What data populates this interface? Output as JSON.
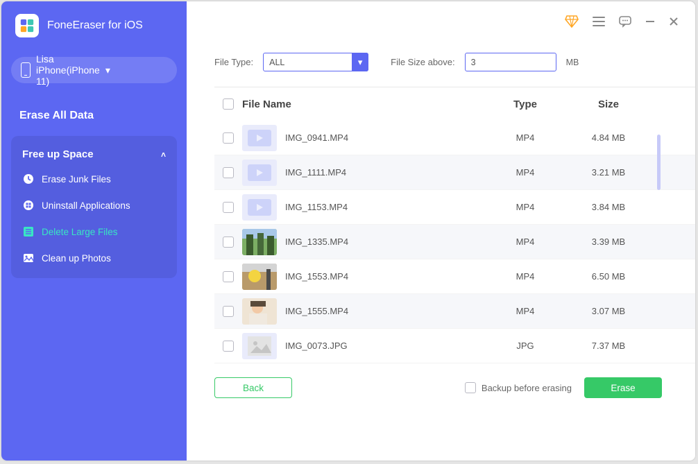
{
  "app": {
    "name": "FoneEraser for iOS"
  },
  "device": {
    "name": "Lisa iPhone(iPhone 11)"
  },
  "sidebar": {
    "nav_title": "Erase All Data",
    "section_head": "Free up Space",
    "items": [
      {
        "label": "Erase Junk Files",
        "icon": "clock"
      },
      {
        "label": "Uninstall Applications",
        "icon": "apps"
      },
      {
        "label": "Delete Large Files",
        "icon": "list",
        "active": true
      },
      {
        "label": "Clean up Photos",
        "icon": "photo"
      }
    ]
  },
  "filters": {
    "type_label": "File Type:",
    "type_value": "ALL",
    "size_label": "File Size above:",
    "size_value": "3",
    "size_unit": "MB"
  },
  "table": {
    "headers": {
      "name": "File Name",
      "type": "Type",
      "size": "Size"
    },
    "rows": [
      {
        "name": "IMG_0941.MP4",
        "type": "MP4",
        "size": "4.84 MB",
        "thumb": "video"
      },
      {
        "name": "IMG_1111.MP4",
        "type": "MP4",
        "size": "3.21 MB",
        "thumb": "video"
      },
      {
        "name": "IMG_1153.MP4",
        "type": "MP4",
        "size": "3.84 MB",
        "thumb": "video"
      },
      {
        "name": "IMG_1335.MP4",
        "type": "MP4",
        "size": "3.39 MB",
        "thumb": "photo1"
      },
      {
        "name": "IMG_1553.MP4",
        "type": "MP4",
        "size": "6.50 MB",
        "thumb": "photo2"
      },
      {
        "name": "IMG_1555.MP4",
        "type": "MP4",
        "size": "3.07 MB",
        "thumb": "photo3"
      },
      {
        "name": "IMG_0073.JPG",
        "type": "JPG",
        "size": "7.37 MB",
        "thumb": "placeholder"
      }
    ]
  },
  "footer": {
    "back": "Back",
    "backup_label": "Backup before erasing",
    "erase": "Erase"
  },
  "colors": {
    "accent": "#5c67f2",
    "success": "#36c967",
    "active": "#38e6c3"
  }
}
